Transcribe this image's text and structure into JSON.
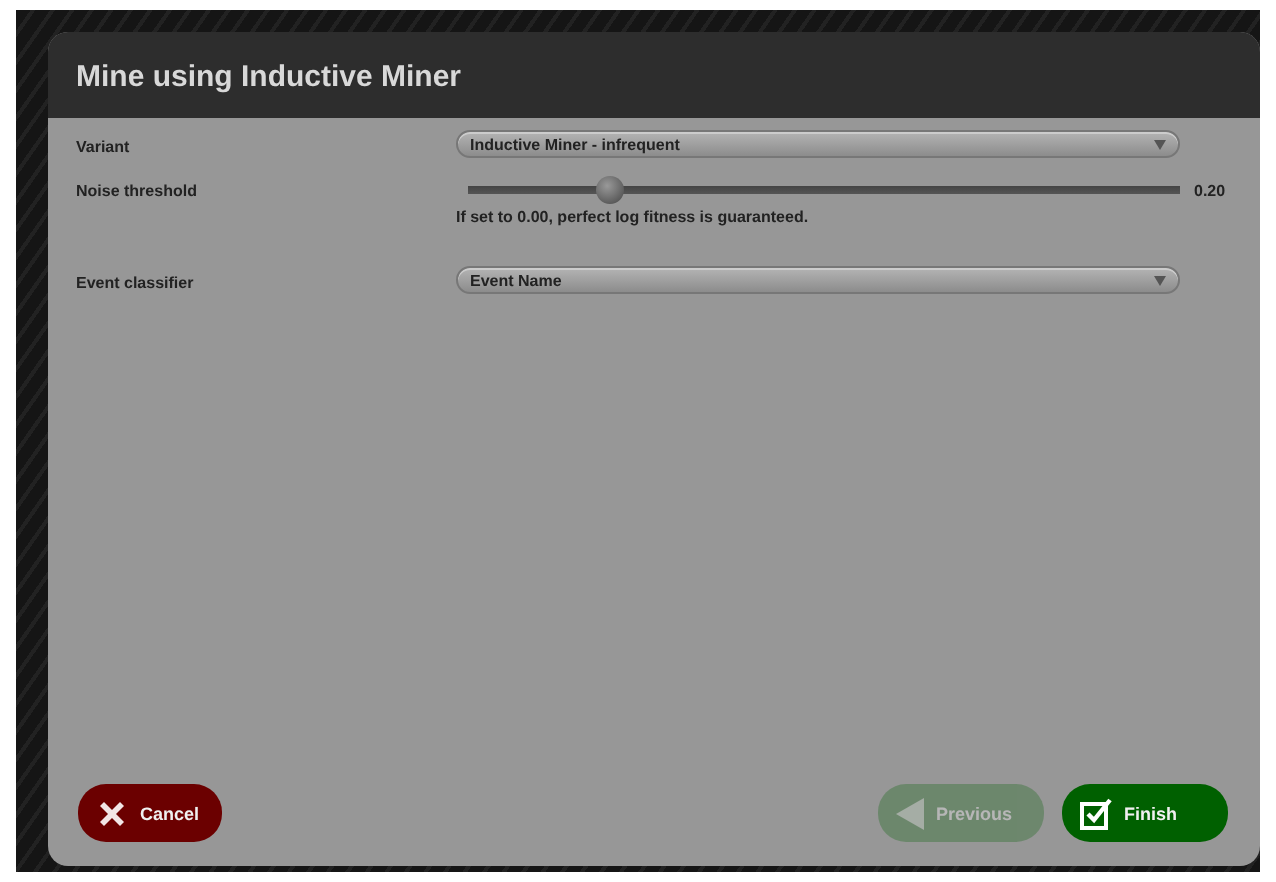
{
  "dialog": {
    "title": "Mine using Inductive Miner"
  },
  "fields": [
    {
      "kind": "dropdown",
      "label": "Variant",
      "value": "Inductive Miner - infrequent"
    },
    {
      "kind": "slider",
      "label": "Noise threshold",
      "level": 0.2,
      "reading": "0.20",
      "hint": "If set to 0.00, perfect log fitness is guaranteed."
    },
    {
      "kind": "dropdown",
      "label": "Event classifier",
      "value": "Event Name"
    }
  ],
  "buttons": [
    {
      "kind": "cancel",
      "label": "Cancel",
      "disabled": false
    },
    {
      "kind": "previous",
      "label": "Previous",
      "disabled": true
    },
    {
      "kind": "finish",
      "label": "Finish",
      "disabled": false
    }
  ]
}
